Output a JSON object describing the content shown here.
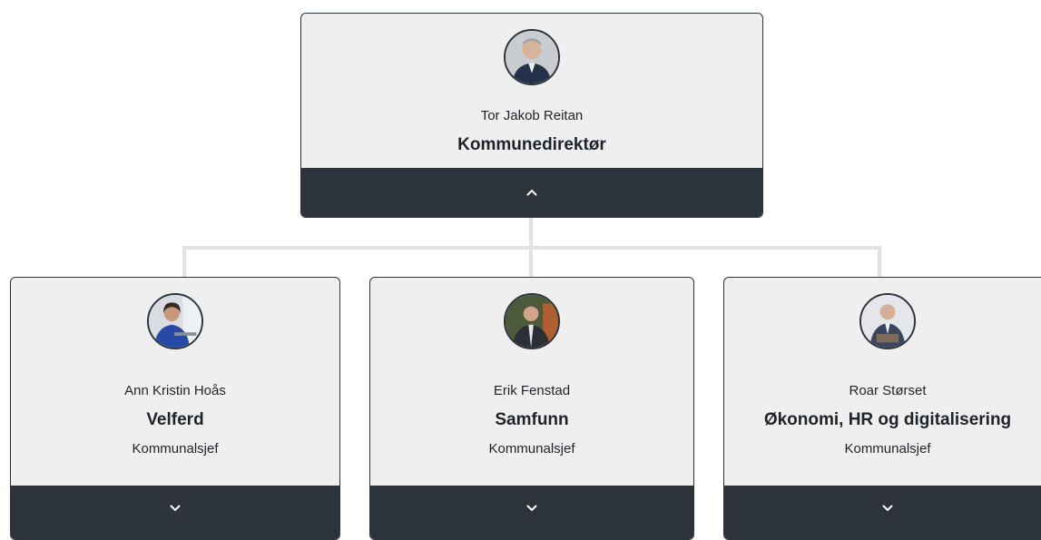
{
  "colors": {
    "card_bg": "#efefef",
    "footer_bg": "#2d333b",
    "connector": "#e3e3e3",
    "text": "#1f2328"
  },
  "root": {
    "name": "Tor Jakob Reitan",
    "title": "Kommunedirektør",
    "toggle_icon": "chevron-up-icon"
  },
  "children": [
    {
      "name": "Ann Kristin Hoås",
      "title": "Velferd",
      "role": "Kommunalsjef",
      "toggle_icon": "chevron-down-icon"
    },
    {
      "name": "Erik Fenstad",
      "title": "Samfunn",
      "role": "Kommunalsjef",
      "toggle_icon": "chevron-down-icon"
    },
    {
      "name": "Roar Størset",
      "title": "Økonomi, HR og digitalisering",
      "role": "Kommunalsjef",
      "toggle_icon": "chevron-down-icon"
    }
  ]
}
